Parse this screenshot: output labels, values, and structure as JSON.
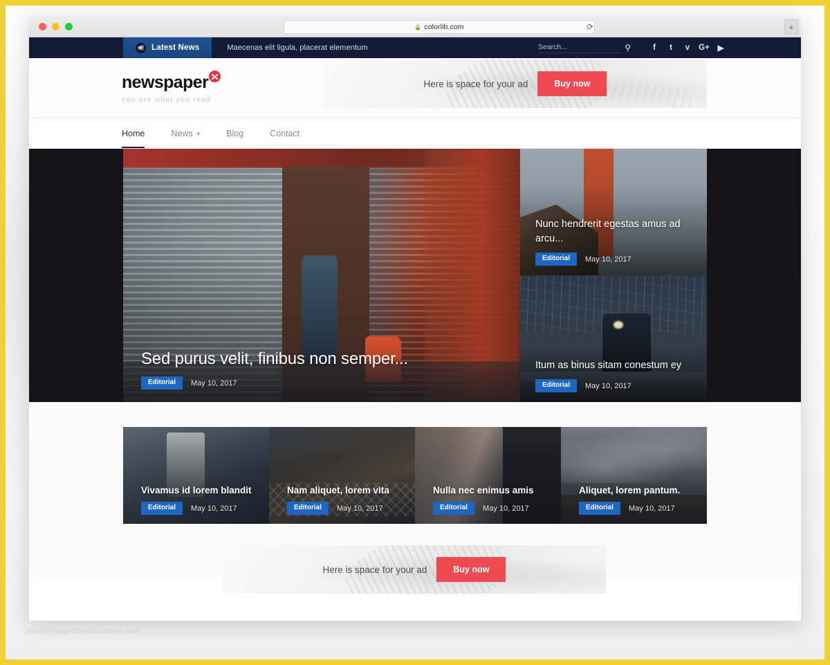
{
  "browser": {
    "url": "colorlib.com",
    "lock_icon": "lock-icon",
    "reload_icon": "reload-icon",
    "newtab_label": "+",
    "traffic_lights": [
      "close",
      "minimize",
      "zoom"
    ]
  },
  "topbar": {
    "latest_news_label": "Latest News",
    "latest_news_icon": "megaphone-icon",
    "ticker_text": "Maecenas elit ligula, placerat elementum",
    "search_placeholder": "Search...",
    "search_value": "",
    "search_icon": "search-icon",
    "socials": [
      {
        "name": "facebook",
        "glyph": "f"
      },
      {
        "name": "tumblr",
        "glyph": "t"
      },
      {
        "name": "twitter",
        "glyph": "ᴠ"
      },
      {
        "name": "google-plus",
        "glyph": "G+"
      },
      {
        "name": "youtube",
        "glyph": "▶"
      }
    ]
  },
  "header": {
    "logo_text": "newspaper",
    "logo_mark": "red-circle-cross-icon",
    "tagline": "you are what you read",
    "ad": {
      "text": "Here is space for your ad",
      "button_label": "Buy now",
      "button_color": "#ef4a4f"
    }
  },
  "nav": {
    "items": [
      {
        "label": "Home",
        "active": true,
        "has_caret": false
      },
      {
        "label": "News",
        "active": false,
        "has_caret": true
      },
      {
        "label": "Blog",
        "active": false,
        "has_caret": false
      },
      {
        "label": "Contact",
        "active": false,
        "has_caret": false
      }
    ],
    "caret_icon": "chevron-down-icon"
  },
  "hero": {
    "featured": {
      "title": "Sed purus velit, finibus non semper...",
      "category": "Editorial",
      "date": "May 10, 2017"
    },
    "side": [
      {
        "title": "Nunc hendrerit egestas amus ad arcu...",
        "category": "Editorial",
        "date": "May 10, 2017"
      },
      {
        "title": "Itum as binus sitam conestum ey",
        "category": "Editorial",
        "date": "May 10, 2017"
      }
    ]
  },
  "cards": [
    {
      "title": "Vivamus id lorem blandit",
      "category": "Editorial",
      "date": "May 10, 2017"
    },
    {
      "title": "Nam aliquet, lorem vita",
      "category": "Editorial",
      "date": "May 10, 2017"
    },
    {
      "title": "Nulla nec enimus amis",
      "category": "Editorial",
      "date": "May 10, 2017"
    },
    {
      "title": "Aliquet, lorem pantum.",
      "category": "Editorial",
      "date": "May 10, 2017"
    }
  ],
  "bottom_ad": {
    "text": "Here is space for your ad",
    "button_label": "Buy now"
  },
  "watermark": "www.heritagechristiancollege.com",
  "colors": {
    "topbar_navy": "#111b36",
    "latest_news_blue": "#1d4d8c",
    "badge_blue": "#1d66c4",
    "accent_red": "#ef4a4f",
    "frame_gold": "#f0d033",
    "hero_backdrop": "#141418"
  }
}
